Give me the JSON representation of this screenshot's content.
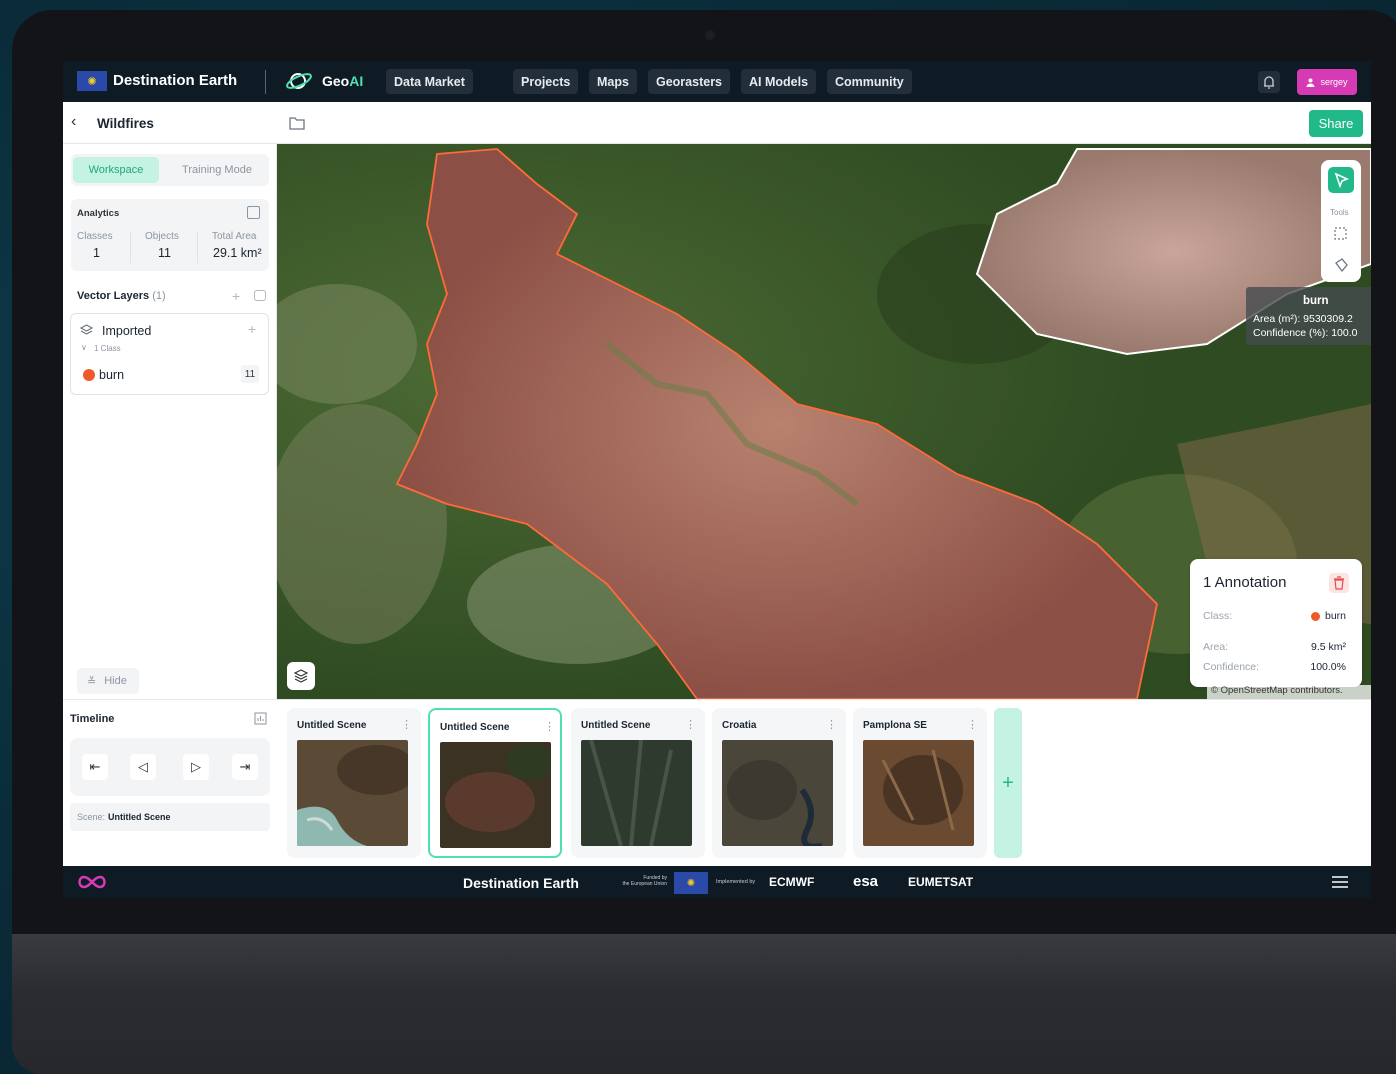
{
  "header": {
    "brand": "Destination Earth",
    "geo_prefix": "Geo",
    "geo_suffix": "AI",
    "nav": [
      "Data Market",
      "Projects",
      "Maps",
      "Georasters",
      "AI Models",
      "Community"
    ],
    "user": "sergey"
  },
  "subheader": {
    "project_title": "Wildfires",
    "share_label": "Share"
  },
  "sidebar": {
    "tabs": {
      "workspace": "Workspace",
      "training": "Training Mode"
    },
    "analytics": {
      "title": "Analytics",
      "classes_label": "Classes",
      "classes_value": "1",
      "objects_label": "Objects",
      "objects_value": "11",
      "area_label": "Total Area",
      "area_value": "29.1 km²"
    },
    "vector_layers": {
      "title": "Vector Layers",
      "count": "(1)",
      "layer_name": "Imported",
      "class_count": "1 Class",
      "class_name": "burn",
      "class_objects": "11"
    },
    "hide_label": "Hide"
  },
  "map": {
    "tools_label": "Tools",
    "tooltip": {
      "title": "burn",
      "area": "Area (m²):   9530309.2",
      "confidence": "Confidence (%):  100.0"
    },
    "annotation": {
      "title": "1 Annotation",
      "class_label": "Class:",
      "class_value": "burn",
      "area_label": "Area:",
      "area_value": "9.5 km²",
      "confidence_label": "Confidence:",
      "confidence_value": "100.0%"
    },
    "attribution": "© OpenStreetMap contributors."
  },
  "timeline": {
    "title": "Timeline",
    "scene_label": "Scene:",
    "scene_value": "Untitled Scene",
    "scenes": [
      "Untitled Scene",
      "Untitled Scene",
      "Untitled Scene",
      "Croatia",
      "Pamplona SE"
    ],
    "add_label": "+"
  },
  "footer": {
    "brand": "Destination Earth",
    "funded_1": "Funded by",
    "funded_2": "the European Union",
    "implemented": "Implemented by",
    "partners": [
      "ECMWF",
      "esa",
      "EUMETSAT"
    ]
  },
  "colors": {
    "accent": "#21b88a",
    "accent_light": "#c4f2e3",
    "burn": "#f05a2a",
    "user": "#d63ab5",
    "topbar": "#0e1a24"
  }
}
